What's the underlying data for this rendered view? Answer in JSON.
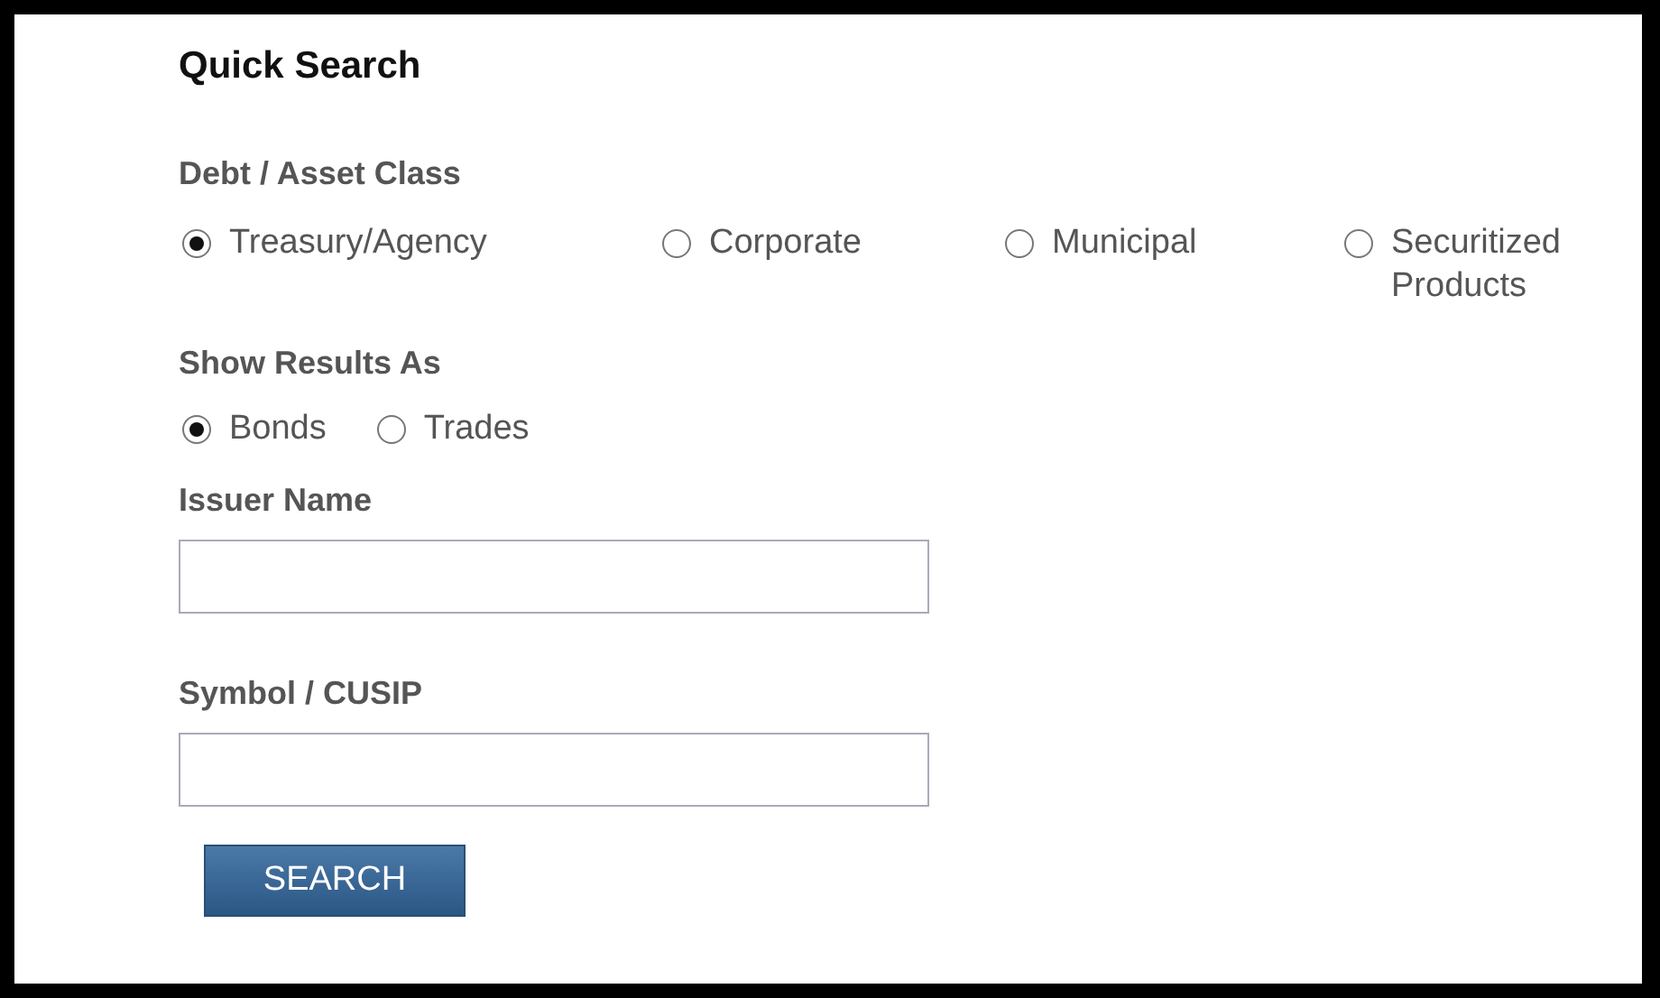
{
  "title": "Quick Search",
  "asset_class": {
    "label": "Debt / Asset Class",
    "options": [
      {
        "label": "Treasury/Agency",
        "selected": true
      },
      {
        "label": "Corporate",
        "selected": false
      },
      {
        "label": "Municipal",
        "selected": false
      },
      {
        "label": "Securitized Products",
        "selected": false
      }
    ]
  },
  "show_results": {
    "label": "Show Results As",
    "options": [
      {
        "label": "Bonds",
        "selected": true
      },
      {
        "label": "Trades",
        "selected": false
      }
    ]
  },
  "issuer_name": {
    "label": "Issuer Name"
  },
  "symbol": {
    "label": "Symbol / CUSIP"
  },
  "search_button": "SEARCH"
}
